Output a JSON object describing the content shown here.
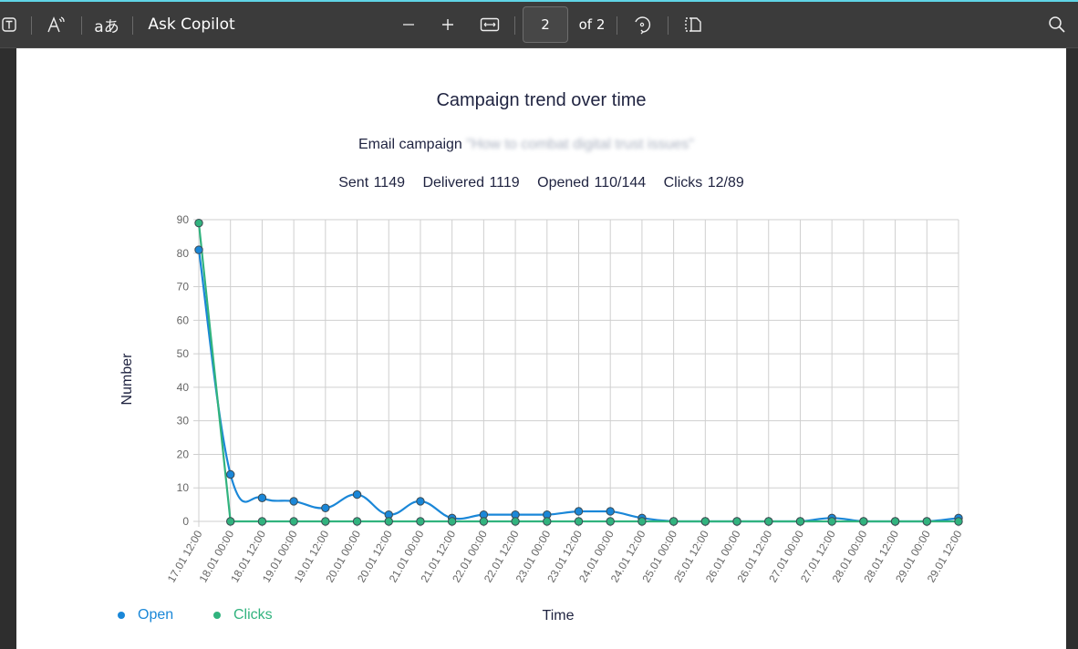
{
  "toolbar": {
    "ask_copilot": "Ask Copilot",
    "page_current": "2",
    "page_of": "of 2",
    "icons": [
      "text-select-icon",
      "read-aloud-icon",
      "translate-icon",
      "zoom-out-icon",
      "zoom-in-icon",
      "fit-width-icon",
      "rotate-icon",
      "page-view-icon",
      "search-icon"
    ]
  },
  "report": {
    "title": "Campaign trend over time",
    "campaign_label": "Email campaign",
    "campaign_name": "\"How to combat digital trust issues\"",
    "stats": {
      "sent": "Sent 1149",
      "delivered": "Delivered 1119",
      "opened": "Opened 110/144",
      "clicks": "Clicks 12/89"
    }
  },
  "colors": {
    "open": "#1a87d8",
    "clicks": "#31b37e",
    "grid": "#d0d0d0",
    "text": "#1f2340"
  },
  "chart_data": {
    "type": "line",
    "title": "Campaign trend over time",
    "xlabel": "Time",
    "ylabel": "Number",
    "ylim": [
      0,
      90
    ],
    "yticks": [
      0,
      10,
      20,
      30,
      40,
      50,
      60,
      70,
      80,
      90
    ],
    "grid": true,
    "legend_position": "bottom-left",
    "x": [
      "17.01 12:00",
      "18.01 00:00",
      "18.01 12:00",
      "19.01 00:00",
      "19.01 12:00",
      "20.01 00:00",
      "20.01 12:00",
      "21.01 00:00",
      "21.01 12:00",
      "22.01 00:00",
      "22.01 12:00",
      "23.01 00:00",
      "23.01 12:00",
      "24.01 00:00",
      "24.01 12:00",
      "25.01 00:00",
      "25.01 12:00",
      "26.01 00:00",
      "26.01 12:00",
      "27.01 00:00",
      "27.01 12:00",
      "28.01 00:00",
      "28.01 12:00",
      "29.01 00:00",
      "29.01 12:00"
    ],
    "series": [
      {
        "name": "Open",
        "smooth": true,
        "values": [
          81,
          14,
          7,
          6,
          4,
          8,
          2,
          6,
          1,
          2,
          2,
          2,
          3,
          3,
          1,
          0,
          0,
          0,
          0,
          0,
          1,
          0,
          0,
          0,
          1
        ]
      },
      {
        "name": "Clicks",
        "smooth": false,
        "values": [
          89,
          0,
          0,
          0,
          0,
          0,
          0,
          0,
          0,
          0,
          0,
          0,
          0,
          0,
          0,
          0,
          0,
          0,
          0,
          0,
          0,
          0,
          0,
          0,
          0
        ]
      }
    ]
  }
}
